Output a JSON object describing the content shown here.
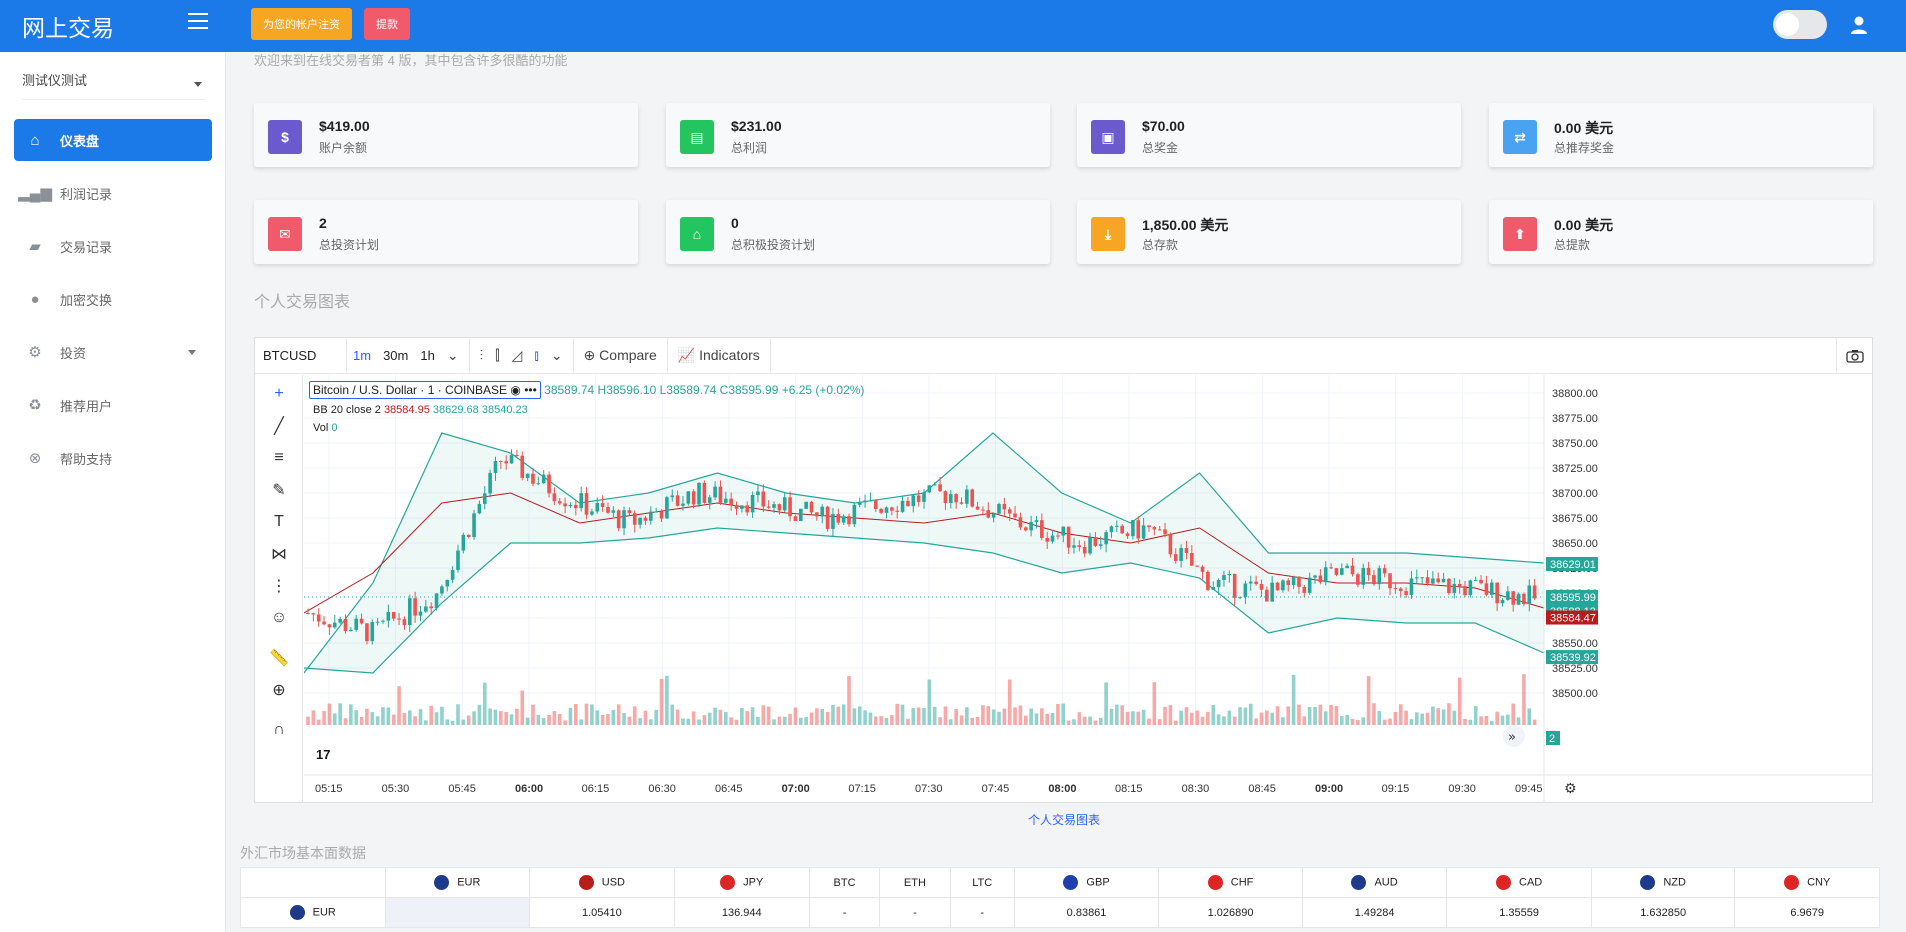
{
  "app": {
    "title": "网上交易"
  },
  "header": {
    "register_label": "为您的帐户注资",
    "withdraw_label": "提款"
  },
  "sidebar": {
    "selector": "测试仪测试",
    "items": [
      {
        "label": "仪表盘",
        "icon": "home-icon",
        "active": true
      },
      {
        "label": "利润记录",
        "icon": "signal-icon"
      },
      {
        "label": "交易记录",
        "icon": "briefcase-icon"
      },
      {
        "label": "加密交换",
        "icon": "coins-icon"
      },
      {
        "label": "投资",
        "icon": "cogs-icon",
        "has_submenu": true
      },
      {
        "label": "推荐用户",
        "icon": "recycle-icon"
      },
      {
        "label": "帮助支持",
        "icon": "lifebuoy-icon"
      }
    ]
  },
  "main": {
    "welcome": "欢迎来到在线交易者第 4 版，其中包含许多很酷的功能",
    "cards": [
      {
        "value": "$419.00",
        "label": "账户余额",
        "color": "#6a5acd",
        "icon": "dollar-icon"
      },
      {
        "value": "$231.00",
        "label": "总利润",
        "color": "#22c55e",
        "icon": "money-icon"
      },
      {
        "value": "$70.00",
        "label": "总奖金",
        "color": "#6a5acd",
        "icon": "gift-icon"
      },
      {
        "value": "0.00 美元",
        "label": "总推荐奖金",
        "color": "#4aa3f0",
        "icon": "retweet-icon"
      },
      {
        "value": "2",
        "label": "总投资计划",
        "color": "#f05a6b",
        "icon": "envelope-icon"
      },
      {
        "value": "0",
        "label": "总积极投资计划",
        "color": "#22c55e",
        "icon": "inbox-icon"
      },
      {
        "value": "1,850.00 美元",
        "label": "总存款",
        "color": "#f6a623",
        "icon": "download-icon"
      },
      {
        "value": "0.00 美元",
        "label": "总提款",
        "color": "#f05a6b",
        "icon": "upload-icon"
      }
    ],
    "chart_section_title": "个人交易图表",
    "chart_link": "个人交易图表"
  },
  "widget": {
    "symbol": "BTCUSD",
    "timeframes": [
      "1m",
      "30m",
      "1h"
    ],
    "active_timeframe": "1m",
    "compare_label": "Compare",
    "indicators_label": "Indicators",
    "legend_title": "Bitcoin / U.S. Dollar · 1 · COINBASE",
    "legend_ohlc": "38589.74 H38596.10 L38589.74 C38595.99 +6.25 (+0.02%)",
    "bb_label": "BB 20 close 2",
    "bb_values": [
      "38584.95",
      "38629.68",
      "38540.23"
    ],
    "vol_label": "Vol",
    "vol_value": "0",
    "vol_badge": "2"
  },
  "chart_data": {
    "type": "candlestick",
    "symbol": "BTCUSD",
    "x": [
      "05:15",
      "05:30",
      "05:45",
      "06:00",
      "06:15",
      "06:30",
      "06:45",
      "07:00",
      "07:15",
      "07:30",
      "07:45",
      "08:00",
      "08:15",
      "08:30",
      "08:45",
      "09:00",
      "09:15",
      "09:30",
      "09:45"
    ],
    "y_ticks": [
      38800.0,
      38775.0,
      38750.0,
      38725.0,
      38700.0,
      38675.0,
      38650.0,
      38625.0,
      38600.0,
      38575.0,
      38550.0,
      38525.0,
      38500.0
    ],
    "ylim": [
      38495,
      38810
    ],
    "close": [
      38580,
      38560,
      38600,
      38735,
      38695,
      38670,
      38700,
      38690,
      38675,
      38690,
      38700,
      38670,
      38650,
      38665,
      38610,
      38600,
      38620,
      38610,
      38605,
      38595
    ],
    "bb_upper": [
      38520,
      38610,
      38760,
      38740,
      38690,
      38700,
      38720,
      38700,
      38690,
      38700,
      38760,
      38700,
      38670,
      38720,
      38640,
      38640,
      38640,
      38635,
      38630
    ],
    "bb_middle": [
      38580,
      38620,
      38690,
      38700,
      38670,
      38680,
      38690,
      38680,
      38675,
      38670,
      38680,
      38660,
      38650,
      38665,
      38620,
      38610,
      38610,
      38605,
      38585
    ],
    "bb_lower": [
      38525,
      38520,
      38590,
      38650,
      38650,
      38655,
      38665,
      38660,
      38655,
      38650,
      38640,
      38620,
      38630,
      38615,
      38560,
      38575,
      38570,
      38570,
      38540
    ],
    "price_labels": [
      {
        "value": "38629.01",
        "color": "#26a69a"
      },
      {
        "value": "38595.99",
        "color": "#26a69a"
      },
      {
        "value": "38588.13",
        "color": "#26a69a"
      },
      {
        "value": "38584.47",
        "color": "#b71c1c"
      },
      {
        "value": "38539.92",
        "color": "#26a69a"
      }
    ]
  },
  "forex": {
    "title": "外汇市场基本面数据",
    "columns": [
      {
        "code": "EUR",
        "flag": "#1e3a8a"
      },
      {
        "code": "USD",
        "flag": "#b91c1c"
      },
      {
        "code": "JPY",
        "flag": "#dc2626"
      },
      {
        "code": "BTC",
        "flag": ""
      },
      {
        "code": "ETH",
        "flag": ""
      },
      {
        "code": "LTC",
        "flag": ""
      },
      {
        "code": "GBP",
        "flag": "#1e40af"
      },
      {
        "code": "CHF",
        "flag": "#dc2626"
      },
      {
        "code": "AUD",
        "flag": "#1e3a8a"
      },
      {
        "code": "CAD",
        "flag": "#dc2626"
      },
      {
        "code": "NZD",
        "flag": "#1e3a8a"
      },
      {
        "code": "CNY",
        "flag": "#dc2626"
      }
    ],
    "rows": [
      {
        "code": "EUR",
        "flag": "#1e3a8a",
        "values": [
          "",
          "1.05410",
          "136.944",
          "-",
          "-",
          "-",
          "0.83861",
          "1.026890",
          "1.49284",
          "1.35559",
          "1.632850",
          "6.9679"
        ]
      }
    ]
  }
}
